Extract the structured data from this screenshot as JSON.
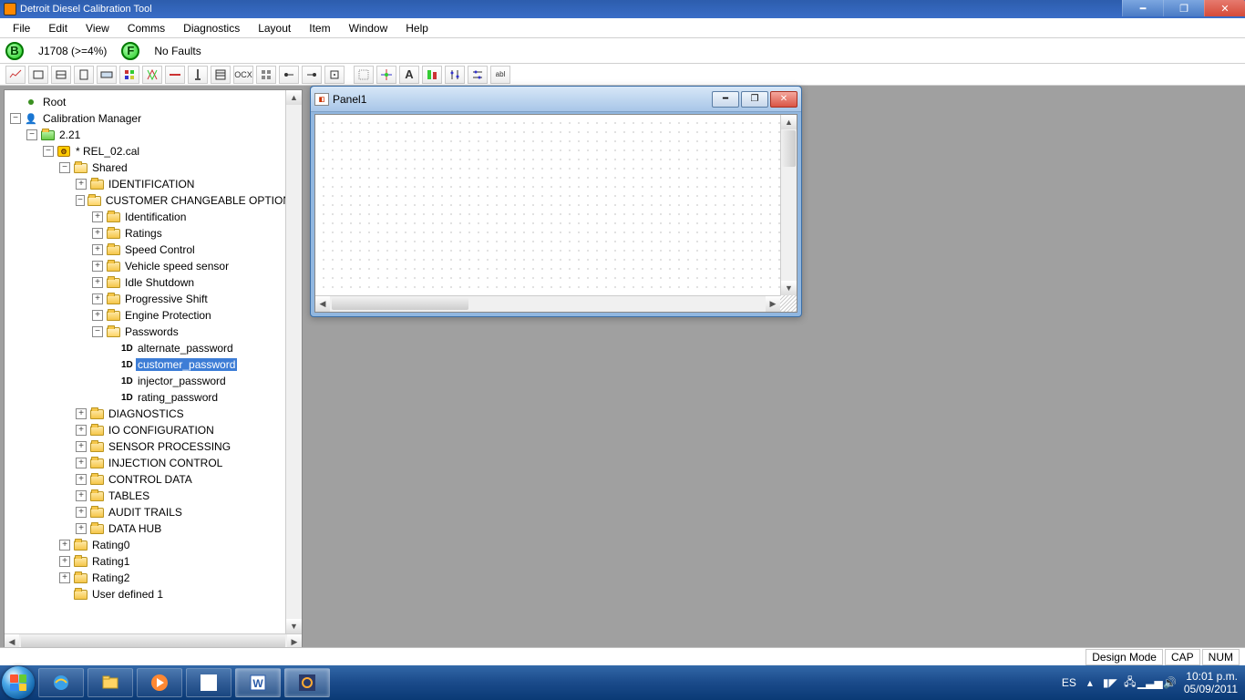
{
  "titlebar": {
    "title": "Detroit Diesel Calibration Tool"
  },
  "menu": {
    "items": [
      "File",
      "Edit",
      "View",
      "Comms",
      "Diagnostics",
      "Layout",
      "Item",
      "Window",
      "Help"
    ]
  },
  "status_strip": {
    "b_label": "B",
    "j1708": "J1708 (>=4%)",
    "f_label": "F",
    "faults": "No Faults"
  },
  "tree": {
    "root": "Root",
    "calmgr": "Calibration Manager",
    "v221": "2.21",
    "rel02": "* REL_02.cal",
    "shared": "Shared",
    "identification_caps": "IDENTIFICATION",
    "cust_opts": "CUSTOMER CHANGEABLE OPTIONS",
    "identification": "Identification",
    "ratings": "Ratings",
    "speed_control": "Speed Control",
    "vss": "Vehicle speed sensor",
    "idle_shutdown": "Idle Shutdown",
    "prog_shift": "Progressive Shift",
    "engine_prot": "Engine Protection",
    "passwords": "Passwords",
    "alternate_password": "alternate_password",
    "customer_password": "customer_password",
    "injector_password": "injector_password",
    "rating_password": "rating_password",
    "diagnostics": "DIAGNOSTICS",
    "io_config": "IO CONFIGURATION",
    "sensor_proc": "SENSOR PROCESSING",
    "inj_ctrl": "INJECTION CONTROL",
    "ctrl_data": "CONTROL DATA",
    "tables": "TABLES",
    "audit": "AUDIT TRAILS",
    "datahub": "DATA HUB",
    "rating0": "Rating0",
    "rating1": "Rating1",
    "rating2": "Rating2",
    "userdef1": "User defined 1"
  },
  "panel": {
    "title": "Panel1"
  },
  "statusbar": {
    "design": "Design Mode",
    "cap": "CAP",
    "num": "NUM"
  },
  "taskbar": {
    "lang": "ES",
    "time": "10:01 p.m.",
    "date": "05/09/2011"
  }
}
